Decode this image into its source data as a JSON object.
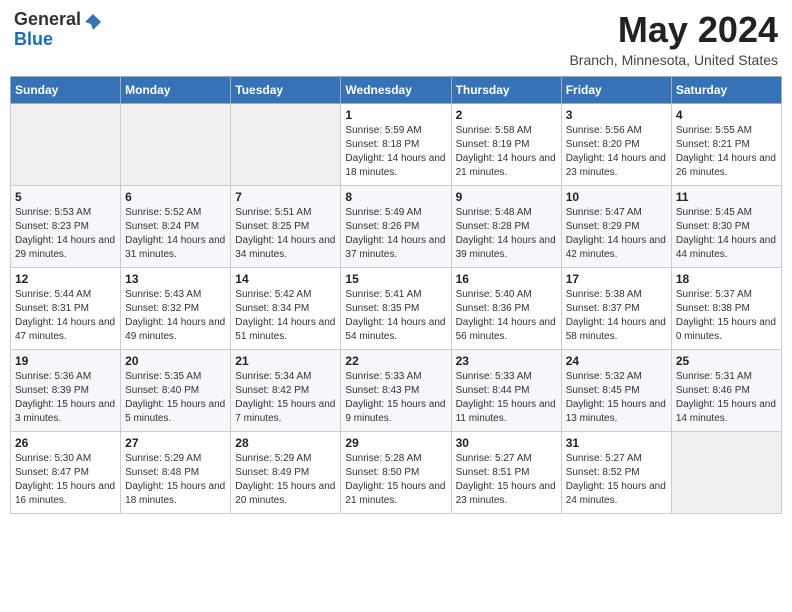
{
  "header": {
    "logo_general": "General",
    "logo_blue": "Blue",
    "title": "May 2024",
    "location": "Branch, Minnesota, United States"
  },
  "days_of_week": [
    "Sunday",
    "Monday",
    "Tuesday",
    "Wednesday",
    "Thursday",
    "Friday",
    "Saturday"
  ],
  "weeks": [
    [
      {
        "day": "",
        "content": ""
      },
      {
        "day": "",
        "content": ""
      },
      {
        "day": "",
        "content": ""
      },
      {
        "day": "1",
        "content": "Sunrise: 5:59 AM\nSunset: 8:18 PM\nDaylight: 14 hours\nand 18 minutes."
      },
      {
        "day": "2",
        "content": "Sunrise: 5:58 AM\nSunset: 8:19 PM\nDaylight: 14 hours\nand 21 minutes."
      },
      {
        "day": "3",
        "content": "Sunrise: 5:56 AM\nSunset: 8:20 PM\nDaylight: 14 hours\nand 23 minutes."
      },
      {
        "day": "4",
        "content": "Sunrise: 5:55 AM\nSunset: 8:21 PM\nDaylight: 14 hours\nand 26 minutes."
      }
    ],
    [
      {
        "day": "5",
        "content": "Sunrise: 5:53 AM\nSunset: 8:23 PM\nDaylight: 14 hours\nand 29 minutes."
      },
      {
        "day": "6",
        "content": "Sunrise: 5:52 AM\nSunset: 8:24 PM\nDaylight: 14 hours\nand 31 minutes."
      },
      {
        "day": "7",
        "content": "Sunrise: 5:51 AM\nSunset: 8:25 PM\nDaylight: 14 hours\nand 34 minutes."
      },
      {
        "day": "8",
        "content": "Sunrise: 5:49 AM\nSunset: 8:26 PM\nDaylight: 14 hours\nand 37 minutes."
      },
      {
        "day": "9",
        "content": "Sunrise: 5:48 AM\nSunset: 8:28 PM\nDaylight: 14 hours\nand 39 minutes."
      },
      {
        "day": "10",
        "content": "Sunrise: 5:47 AM\nSunset: 8:29 PM\nDaylight: 14 hours\nand 42 minutes."
      },
      {
        "day": "11",
        "content": "Sunrise: 5:45 AM\nSunset: 8:30 PM\nDaylight: 14 hours\nand 44 minutes."
      }
    ],
    [
      {
        "day": "12",
        "content": "Sunrise: 5:44 AM\nSunset: 8:31 PM\nDaylight: 14 hours\nand 47 minutes."
      },
      {
        "day": "13",
        "content": "Sunrise: 5:43 AM\nSunset: 8:32 PM\nDaylight: 14 hours\nand 49 minutes."
      },
      {
        "day": "14",
        "content": "Sunrise: 5:42 AM\nSunset: 8:34 PM\nDaylight: 14 hours\nand 51 minutes."
      },
      {
        "day": "15",
        "content": "Sunrise: 5:41 AM\nSunset: 8:35 PM\nDaylight: 14 hours\nand 54 minutes."
      },
      {
        "day": "16",
        "content": "Sunrise: 5:40 AM\nSunset: 8:36 PM\nDaylight: 14 hours\nand 56 minutes."
      },
      {
        "day": "17",
        "content": "Sunrise: 5:38 AM\nSunset: 8:37 PM\nDaylight: 14 hours\nand 58 minutes."
      },
      {
        "day": "18",
        "content": "Sunrise: 5:37 AM\nSunset: 8:38 PM\nDaylight: 15 hours\nand 0 minutes."
      }
    ],
    [
      {
        "day": "19",
        "content": "Sunrise: 5:36 AM\nSunset: 8:39 PM\nDaylight: 15 hours\nand 3 minutes."
      },
      {
        "day": "20",
        "content": "Sunrise: 5:35 AM\nSunset: 8:40 PM\nDaylight: 15 hours\nand 5 minutes."
      },
      {
        "day": "21",
        "content": "Sunrise: 5:34 AM\nSunset: 8:42 PM\nDaylight: 15 hours\nand 7 minutes."
      },
      {
        "day": "22",
        "content": "Sunrise: 5:33 AM\nSunset: 8:43 PM\nDaylight: 15 hours\nand 9 minutes."
      },
      {
        "day": "23",
        "content": "Sunrise: 5:33 AM\nSunset: 8:44 PM\nDaylight: 15 hours\nand 11 minutes."
      },
      {
        "day": "24",
        "content": "Sunrise: 5:32 AM\nSunset: 8:45 PM\nDaylight: 15 hours\nand 13 minutes."
      },
      {
        "day": "25",
        "content": "Sunrise: 5:31 AM\nSunset: 8:46 PM\nDaylight: 15 hours\nand 14 minutes."
      }
    ],
    [
      {
        "day": "26",
        "content": "Sunrise: 5:30 AM\nSunset: 8:47 PM\nDaylight: 15 hours\nand 16 minutes."
      },
      {
        "day": "27",
        "content": "Sunrise: 5:29 AM\nSunset: 8:48 PM\nDaylight: 15 hours\nand 18 minutes."
      },
      {
        "day": "28",
        "content": "Sunrise: 5:29 AM\nSunset: 8:49 PM\nDaylight: 15 hours\nand 20 minutes."
      },
      {
        "day": "29",
        "content": "Sunrise: 5:28 AM\nSunset: 8:50 PM\nDaylight: 15 hours\nand 21 minutes."
      },
      {
        "day": "30",
        "content": "Sunrise: 5:27 AM\nSunset: 8:51 PM\nDaylight: 15 hours\nand 23 minutes."
      },
      {
        "day": "31",
        "content": "Sunrise: 5:27 AM\nSunset: 8:52 PM\nDaylight: 15 hours\nand 24 minutes."
      },
      {
        "day": "",
        "content": ""
      }
    ]
  ]
}
